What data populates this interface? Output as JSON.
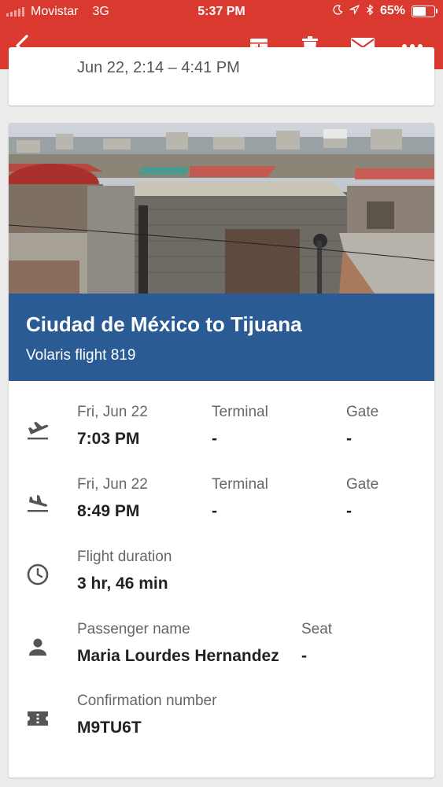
{
  "status_bar": {
    "carrier": "Movistar",
    "network": "3G",
    "time": "5:37 PM",
    "battery": "65%",
    "battery_level": 0.65,
    "icons": [
      "moon-icon",
      "location-arrow-icon",
      "bluetooth-icon"
    ]
  },
  "toolbar": {
    "actions": [
      "back-icon",
      "archive-icon",
      "delete-icon",
      "mail-icon",
      "more-icon"
    ]
  },
  "previous_card": {
    "text": "Jun 22, 2:14 – 4:41 PM"
  },
  "flight": {
    "title": "Ciudad de México to Tijuana",
    "subtitle": "Volaris flight 819",
    "departure": {
      "date": "Fri, Jun 22",
      "time": "7:03 PM",
      "terminal_label": "Terminal",
      "terminal": "-",
      "gate_label": "Gate",
      "gate": "-"
    },
    "arrival": {
      "date": "Fri, Jun 22",
      "time": "8:49 PM",
      "terminal_label": "Terminal",
      "terminal": "-",
      "gate_label": "Gate",
      "gate": "-"
    },
    "duration": {
      "label": "Flight duration",
      "value": "3 hr, 46 min"
    },
    "passenger": {
      "label": "Passenger name",
      "value": "Maria Lourdes Hernandez",
      "seat_label": "Seat",
      "seat": "-"
    },
    "confirmation": {
      "label": "Confirmation number",
      "value": "M9TU6T"
    }
  },
  "colors": {
    "app_bar": "#d9392f",
    "banner": "#2b5b95",
    "background": "#ececec"
  }
}
